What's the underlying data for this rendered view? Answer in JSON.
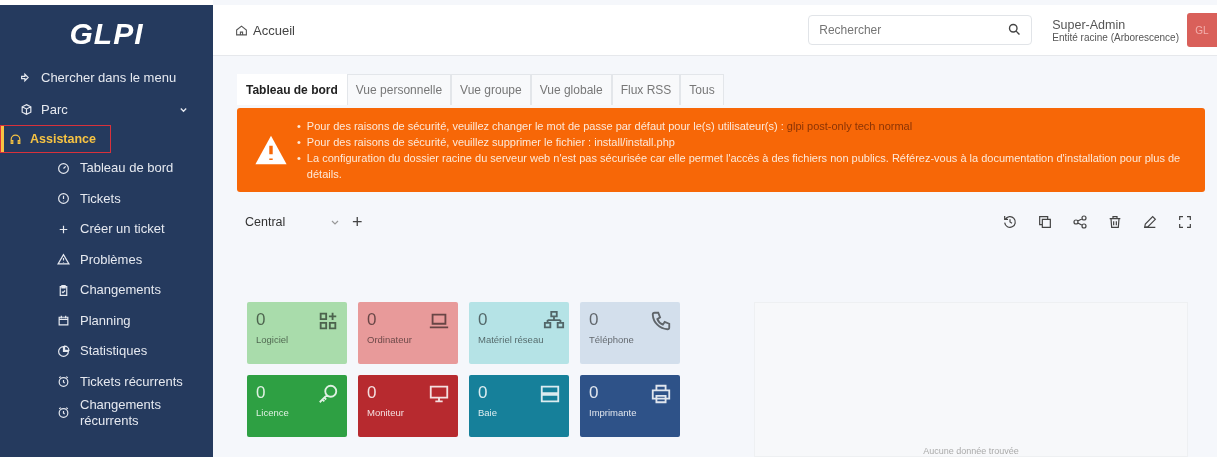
{
  "sidebar": {
    "logo": "GLPI",
    "items": [
      {
        "label": "Chercher dans le menu",
        "selected": false,
        "kind": "search"
      },
      {
        "label": "Parc",
        "selected": false,
        "kind": "section"
      },
      {
        "label": "Assistance",
        "selected": true,
        "kind": "section",
        "children": [
          {
            "label": "Tableau de bord"
          },
          {
            "label": "Tickets"
          },
          {
            "label": "Créer un ticket"
          },
          {
            "label": "Problèmes"
          },
          {
            "label": "Changements"
          },
          {
            "label": "Planning"
          },
          {
            "label": "Statistiques"
          },
          {
            "label": "Tickets récurrents"
          },
          {
            "label": "Changements récurrents"
          }
        ]
      }
    ]
  },
  "header": {
    "breadcrumb": "Accueil",
    "search": {
      "placeholder": "Rechercher"
    },
    "user": {
      "name": "Super-Admin",
      "entity": "Entité racine (Arborescence)",
      "initials": "GL"
    }
  },
  "tabs": [
    {
      "label": "Tableau de bord",
      "selected": true
    },
    {
      "label": "Vue personnelle",
      "selected": false
    },
    {
      "label": "Vue groupe",
      "selected": false
    },
    {
      "label": "Vue globale",
      "selected": false
    },
    {
      "label": "Flux RSS",
      "selected": false
    },
    {
      "label": "Tous",
      "selected": false
    }
  ],
  "alert": {
    "items": [
      {
        "marker": "•",
        "text": "Pour des raisons de sécurité, veuillez changer le mot de passe par défaut pour le(s) utilisateur(s) :",
        "users": "glpi post-only tech normal"
      },
      {
        "marker": "•",
        "text": "Pour des raisons de sécurité, veuillez supprimer le fichier : install/install.php"
      },
      {
        "marker": "•",
        "text": "La configuration du dossier racine du serveur web n'est pas sécurisée car elle permet l'accès à des fichiers non publics. Référez-vous à la documentation d'installation pour plus de détails."
      }
    ]
  },
  "dashboard": {
    "selector": "Central",
    "add": "+",
    "tiles": [
      {
        "count": "0",
        "label": "Logiciel",
        "kind": "apps",
        "color": "#a9dcab"
      },
      {
        "count": "0",
        "label": "Ordinateur",
        "kind": "laptop",
        "color": "#e89a9a"
      },
      {
        "count": "0",
        "label": "Matériel réseau",
        "kind": "network",
        "color": "#b5e3e6"
      },
      {
        "count": "0",
        "label": "Téléphone",
        "kind": "phone",
        "color": "#d3dfec"
      },
      {
        "count": "0",
        "label": "Licence",
        "kind": "key",
        "color": "#2ea043"
      },
      {
        "count": "0",
        "label": "Moniteur",
        "kind": "monitor",
        "color": "#b72a2f"
      },
      {
        "count": "0",
        "label": "Baie",
        "kind": "server",
        "color": "#16809a"
      },
      {
        "count": "0",
        "label": "Imprimante",
        "kind": "printer",
        "color": "#2e5288"
      }
    ],
    "empty": "Aucune donnée trouvée"
  }
}
